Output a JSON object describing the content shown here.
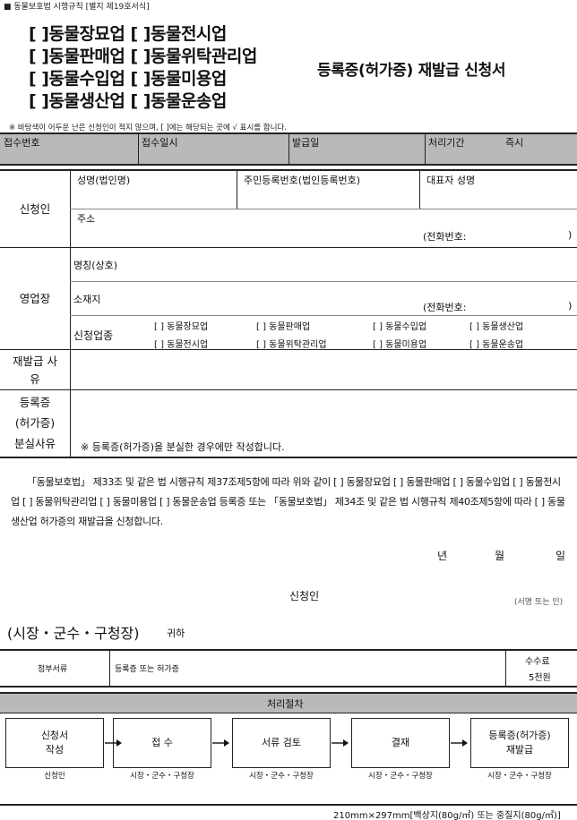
{
  "header_note": "■ 동물보호법 시행규칙 [별지 제19호서식]",
  "categories": {
    "line1": "[ ]동물장묘업 [ ]동물전시업",
    "line2": "[ ]동물판매업 [ ]동물위탁관리업",
    "line3": "[ ]동물수입업 [ ]동물미용업",
    "line4": "[ ]동물생산업 [ ]동물운송업"
  },
  "form_title": "등록증(허가증) 재발급 신청서",
  "sub_note": "※ 바탕색이 어두운 난은 신청인이 적지 않으며, [  ]에는 해당되는 곳에 √ 표시를 합니다.",
  "office_row": {
    "receipt_no": "접수번호",
    "receipt_date": "접수일시",
    "issue_date": "발급일",
    "processing_period": "처리기간",
    "processing_value": "즉시"
  },
  "applicant": {
    "section": "신청인",
    "name": "성명(법인명)",
    "id_no": "주민등록번호(법인등록번호)",
    "rep_name": "대표자 성명",
    "address": "주소",
    "phone": "(전화번호:",
    "phone_close": ")"
  },
  "business": {
    "section": "영업장",
    "name": "명칭(상호)",
    "location": "소재지",
    "phone": "(전화번호:",
    "phone_close": ")",
    "types_label": "신청업종",
    "types": {
      "t1": "[  ] 동물장묘업",
      "t2": "[  ] 동물판매업",
      "t3": "[  ] 동물수입업",
      "t4": "[  ] 동물생산업",
      "t5": "[  ] 동물전시업",
      "t6": "[  ] 동물위탁관리업",
      "t7": "[  ] 동물미용업",
      "t8": "[  ] 동물운송업"
    }
  },
  "reissue_reason": {
    "label1": "재발급 사",
    "label2": "유"
  },
  "loss_reason": {
    "label1": "등록증",
    "label2": "(허가증)",
    "label3": "분실사유",
    "note": "※ 등록증(허가증)을 분실한 경우에만 작성합니다."
  },
  "declaration": "「동물보호법」 제33조 및 같은 법 시행규칙 제37조제5항에 따라 위와 같이 [  ] 동물장묘업  [  ] 동물판매업 [  ] 동물수입업 [  ] 동물전시업 [  ] 동물위탁관리업 [  ] 동물미용업 [  ] 동물운송업 등록증 또는 「동물보호법」 제34조 및 같은 법 시행규칙 제40조제5항에 따라 [  ] 동물생산업 허가증의 재발급을 신청합니다.",
  "date_line": {
    "year": "년",
    "month": "월",
    "day": "일"
  },
  "signature": {
    "label": "신청인",
    "note": "(서명 또는 인)"
  },
  "recipient": "(시장・군수・구청장)",
  "recipient_suffix": "귀하",
  "attachments": {
    "label": "첨부서류",
    "value": "등록증 또는 허가증",
    "fee_label": "수수료",
    "fee_value": "5천원"
  },
  "procedure": {
    "title": "처리절차",
    "steps": [
      {
        "box": "신청서\n작성",
        "who": "신청인"
      },
      {
        "box": "접 수",
        "who": "시장・군수・구청장"
      },
      {
        "box": "서류 검토",
        "who": "시장・군수・구청장"
      },
      {
        "box": "결재",
        "who": "시장・군수・구청장"
      },
      {
        "box": "등록증(허가증)\n재발급",
        "who": "시장・군수・구청장"
      }
    ]
  },
  "footer_paper": "210mm×297mm[백상지(80g/㎡) 또는 중질지(80g/㎡)]"
}
